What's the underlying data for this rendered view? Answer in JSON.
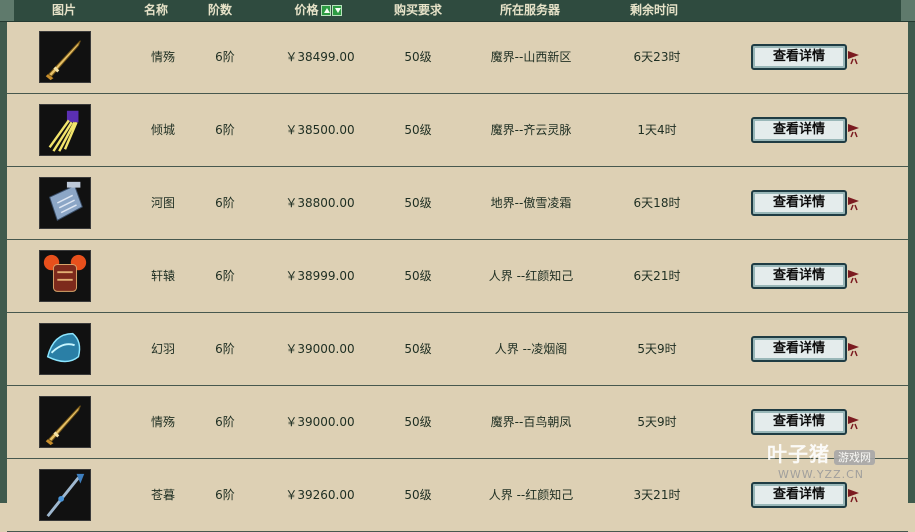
{
  "header": {
    "col_image": "图片",
    "col_name": "名称",
    "col_tier": "阶数",
    "col_price": "价格",
    "col_requirement": "购买要求",
    "col_server": "所在服务器",
    "col_remaining": "剩余时间"
  },
  "rows": [
    {
      "name": "情殇",
      "tier": "6阶",
      "price": "￥38499.00",
      "requirement": "50级",
      "server": "魔界--山西新区",
      "remaining": "6天23时",
      "button": "查看详情",
      "icon": "sword-icon"
    },
    {
      "name": "倾城",
      "tier": "6阶",
      "price": "￥38500.00",
      "requirement": "50级",
      "server": "魔界--齐云灵脉",
      "remaining": "1天4时",
      "button": "查看详情",
      "icon": "claw-icon"
    },
    {
      "name": "河图",
      "tier": "6阶",
      "price": "￥38800.00",
      "requirement": "50级",
      "server": "地界--傲雪凌霜",
      "remaining": "6天18时",
      "button": "查看详情",
      "icon": "scroll-icon"
    },
    {
      "name": "轩辕",
      "tier": "6阶",
      "price": "￥38999.00",
      "requirement": "50级",
      "server": "人界 --红颜知己",
      "remaining": "6天21时",
      "button": "查看详情",
      "icon": "armor-icon"
    },
    {
      "name": "幻羽",
      "tier": "6阶",
      "price": "￥39000.00",
      "requirement": "50级",
      "server": "人界 --凌烟阁",
      "remaining": "5天9时",
      "button": "查看详情",
      "icon": "helmet-icon"
    },
    {
      "name": "情殇",
      "tier": "6阶",
      "price": "￥39000.00",
      "requirement": "50级",
      "server": "魔界--百鸟朝凤",
      "remaining": "5天9时",
      "button": "查看详情",
      "icon": "sword-icon"
    },
    {
      "name": "苍暮",
      "tier": "6阶",
      "price": "￥39260.00",
      "requirement": "50级",
      "server": "人界 --红颜知己",
      "remaining": "3天21时",
      "button": "查看详情",
      "icon": "spear-icon"
    }
  ],
  "watermark": {
    "line1": "叶子猪",
    "badge": "游戏网",
    "line2": "WWW.YZZ.CN"
  }
}
